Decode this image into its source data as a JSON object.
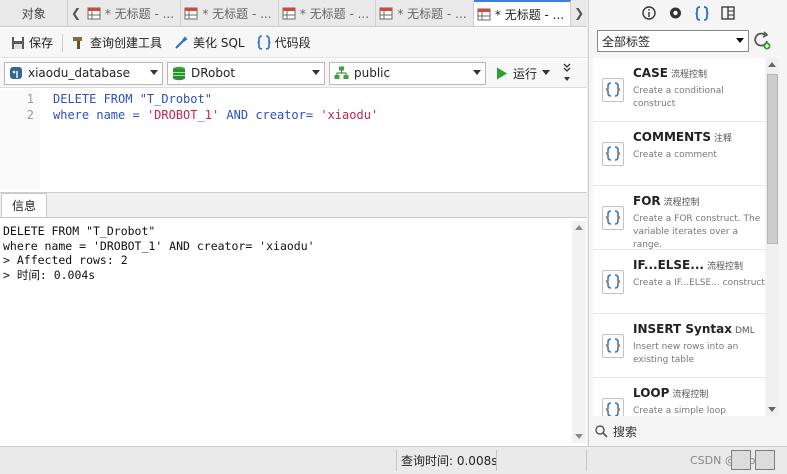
{
  "tabs": {
    "objects_label": "对象",
    "items": [
      {
        "label": "* 无标题 - ...",
        "active": false
      },
      {
        "label": "* 无标题 - ...",
        "active": false
      },
      {
        "label": "* 无标题 - ...",
        "active": false
      },
      {
        "label": "* 无标题 - ...",
        "active": false
      },
      {
        "label": "* 无标题 - ...",
        "active": true
      }
    ]
  },
  "toolbar": {
    "save_label": "保存",
    "query_builder_label": "查询创建工具",
    "beautify_label": "美化 SQL",
    "snippet_label": "代码段"
  },
  "selectors": {
    "connection": "xiaodu_database",
    "database": "DRobot",
    "schema": "public",
    "run_label": "运行"
  },
  "editor": {
    "lines": [
      {
        "num": "1",
        "parts": [
          [
            "kw",
            "DELETE FROM "
          ],
          [
            "plain",
            "\"T_Drobot\""
          ]
        ]
      },
      {
        "num": "2",
        "parts": [
          [
            "kw",
            "where "
          ],
          [
            "plain",
            "name = "
          ],
          [
            "str",
            "'DROBOT_1'"
          ],
          [
            "kw",
            " AND "
          ],
          [
            "plain",
            "creator= "
          ],
          [
            "str",
            "'xiaodu'"
          ]
        ]
      }
    ]
  },
  "result": {
    "tab_label": "信息",
    "lines": [
      "DELETE FROM \"T_Drobot\"",
      "where name = 'DROBOT_1' AND creator= 'xiaodu'",
      "> Affected rows: 2",
      "> 时间: 0.004s"
    ]
  },
  "sidebar": {
    "filter_value": "全部标签",
    "search_label": "搜索",
    "snippets": [
      {
        "title": "CASE",
        "tag": "流程控制",
        "desc": "Create a conditional construct"
      },
      {
        "title": "COMMENTS",
        "tag": "注释",
        "desc": "Create a comment"
      },
      {
        "title": "FOR",
        "tag": "流程控制",
        "desc": "Create a FOR construct. The variable iterates over a range."
      },
      {
        "title": "IF...ELSE...",
        "tag": "流程控制",
        "desc": "Create a IF...ELSE... construct"
      },
      {
        "title": "INSERT Syntax",
        "tag": "DML",
        "desc": "Insert new rows into an existing table"
      },
      {
        "title": "LOOP",
        "tag": "流程控制",
        "desc": "Create a simple loop construct"
      }
    ]
  },
  "status": {
    "query_time": "查询时间: 0.008s",
    "watermark": "CSDN @Drobot"
  },
  "colors": {
    "keyword": "#2b50c8",
    "string": "#c7254e",
    "run_green": "#2ea02e",
    "accent_blue": "#3b7fd9"
  }
}
